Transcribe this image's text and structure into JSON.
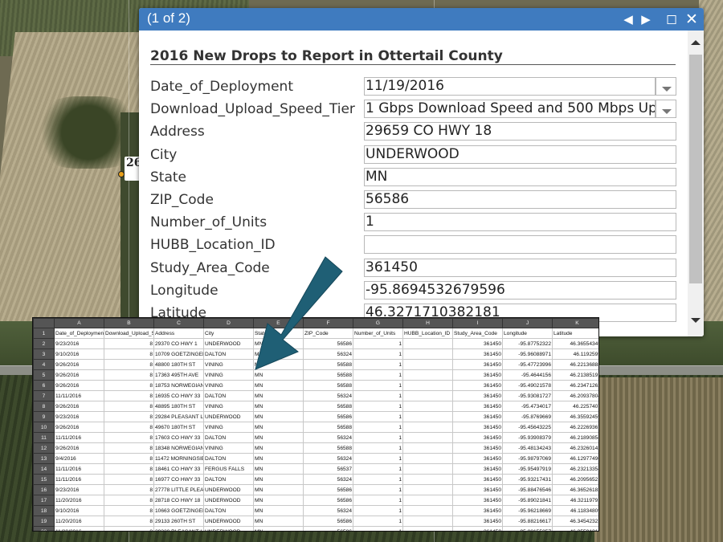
{
  "popup": {
    "pager": "(1 of 2)",
    "title": "2016 New Drops to Report in Ottertail County",
    "fields": [
      {
        "label": "Date_of_Deployment",
        "value": "11/19/2016",
        "dropdown": true
      },
      {
        "label": "Download_Upload_Speed_Tier",
        "value": "1 Gbps Download Speed and 500 Mbps Upload",
        "dropdown": true
      },
      {
        "label": "Address",
        "value": "29659 CO HWY 18"
      },
      {
        "label": "City",
        "value": "UNDERWOOD"
      },
      {
        "label": "State",
        "value": "MN"
      },
      {
        "label": "ZIP_Code",
        "value": "56586"
      },
      {
        "label": "Number_of_Units",
        "value": "1"
      },
      {
        "label": "HUBB_Location_ID",
        "value": ""
      },
      {
        "label": "Study_Area_Code",
        "value": "361450"
      },
      {
        "label": "Longitude",
        "value": "-95.8694532679596"
      },
      {
        "label": "Latitude",
        "value": "46.3271710382181"
      }
    ]
  },
  "map": {
    "label": "26"
  },
  "colors": {
    "header": "#3f7bbf",
    "arrow": "#1f5f75"
  },
  "sheet": {
    "col_letters": [
      "",
      "A",
      "B",
      "C",
      "D",
      "E",
      "F",
      "G",
      "H",
      "I",
      "J",
      "K"
    ],
    "headers": [
      "Date_of_Deployment",
      "Download_Upload_Speed_Tier",
      "Address",
      "City",
      "State",
      "ZIP_Code",
      "Number_of_Units",
      "HUBB_Location_ID",
      "Study_Area_Code",
      "Longitude",
      "Latitude"
    ],
    "rows": [
      [
        "9/23/2016",
        "8",
        "29370 CO HWY 1",
        "UNDERWOOD",
        "MN",
        "56586",
        "1",
        "",
        "361450",
        "-95.87752322",
        "46.36554345"
      ],
      [
        "9/10/2016",
        "8",
        "10709 GOETZINGER",
        "DALTON",
        "MN",
        "56324",
        "1",
        "",
        "361450",
        "-95.96088971",
        "46.1192595"
      ],
      [
        "9/26/2016",
        "8",
        "48800 180TH ST",
        "VINING",
        "MN",
        "56588",
        "1",
        "",
        "361450",
        "-95.47723996",
        "46.22136888"
      ],
      [
        "9/26/2016",
        "8",
        "17363 495TH AVE",
        "VINING",
        "MN",
        "56588",
        "1",
        "",
        "361450",
        "-95.4644156",
        "46.21385191"
      ],
      [
        "9/26/2016",
        "8",
        "18753 NORWEGIAN",
        "VINING",
        "MN",
        "56588",
        "1",
        "",
        "361450",
        "-95.49021578",
        "46.23471262"
      ],
      [
        "11/11/2016",
        "8",
        "16935 CO HWY 33",
        "DALTON",
        "MN",
        "56324",
        "1",
        "",
        "361450",
        "-95.93081727",
        "46.20937804"
      ],
      [
        "9/26/2016",
        "8",
        "48895 180TH ST",
        "VINING",
        "MN",
        "56588",
        "1",
        "",
        "361450",
        "-95.4734017",
        "46.2257407"
      ],
      [
        "9/23/2016",
        "8",
        "29284 PLEASANT L",
        "UNDERWOOD",
        "MN",
        "56586",
        "1",
        "",
        "361450",
        "-95.8769669",
        "46.35592459"
      ],
      [
        "9/26/2016",
        "8",
        "49670 180TH ST",
        "VINING",
        "MN",
        "56588",
        "1",
        "",
        "361450",
        "-95.45643225",
        "46.22269367"
      ],
      [
        "11/11/2016",
        "8",
        "17603 CO HWY 33",
        "DALTON",
        "MN",
        "56324",
        "1",
        "",
        "361450",
        "-95.93908379",
        "46.21890854"
      ],
      [
        "9/26/2016",
        "8",
        "18348 NORWEGIAN",
        "VINING",
        "MN",
        "56588",
        "1",
        "",
        "361450",
        "-95.48134243",
        "46.23260142"
      ],
      [
        "9/4/2016",
        "8",
        "11472 MORNINGSIE",
        "DALTON",
        "MN",
        "56324",
        "1",
        "",
        "361450",
        "-95.98797069",
        "46.12977496"
      ],
      [
        "11/11/2016",
        "8",
        "18461 CO HWY 33",
        "FERGUS FALLS",
        "MN",
        "56537",
        "1",
        "",
        "361450",
        "-95.95497919",
        "46.23213354"
      ],
      [
        "11/11/2016",
        "8",
        "16977 CO HWY 33",
        "DALTON",
        "MN",
        "56324",
        "1",
        "",
        "361450",
        "-95.93217431",
        "46.20956521"
      ],
      [
        "9/23/2016",
        "8",
        "27778 LITTLE PLEA",
        "UNDERWOOD",
        "MN",
        "56586",
        "1",
        "",
        "361450",
        "-95.88476546",
        "46.36526182"
      ],
      [
        "11/20/2016",
        "8",
        "28718 CO HWY 18",
        "UNDERWOOD",
        "MN",
        "56586",
        "1",
        "",
        "361450",
        "-95.89021841",
        "46.32119791"
      ],
      [
        "9/10/2016",
        "8",
        "10663 GOETZINGEI",
        "DALTON",
        "MN",
        "56324",
        "1",
        "",
        "361450",
        "-95.96218669",
        "46.11834809"
      ],
      [
        "11/20/2016",
        "8",
        "29133 260TH ST",
        "UNDERWOOD",
        "MN",
        "56586",
        "1",
        "",
        "361450",
        "-95.88216617",
        "46.34542323"
      ],
      [
        "11/20/2016",
        "8",
        "29320 PLEASANT L",
        "UNDERWOOD",
        "MN",
        "56586",
        "1",
        "",
        "361450",
        "-95.88155257",
        "46.35591313"
      ]
    ]
  }
}
